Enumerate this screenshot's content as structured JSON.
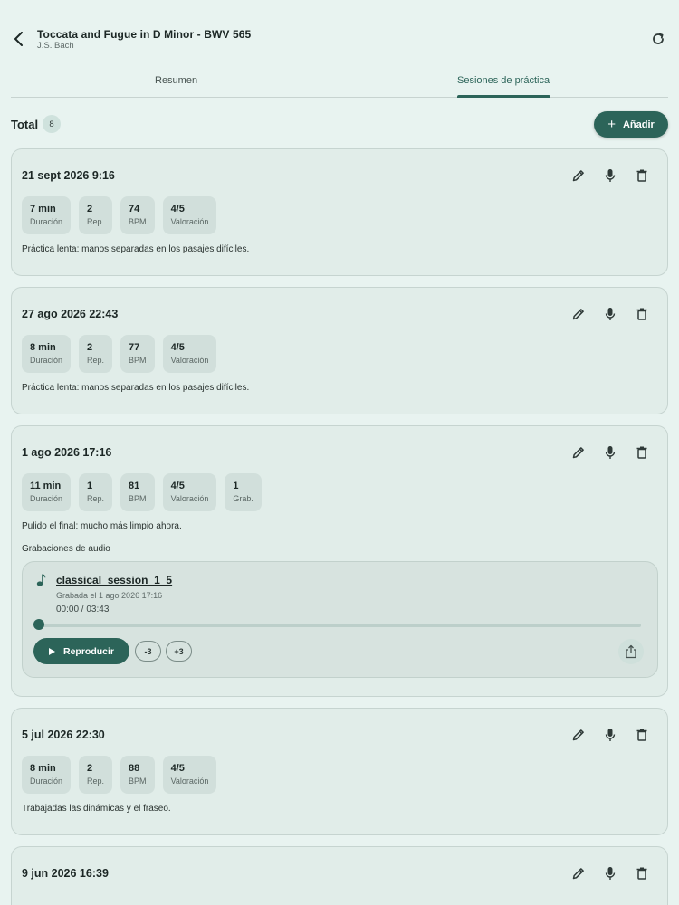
{
  "header": {
    "title": "Toccata and Fugue in D Minor - BWV 565",
    "subtitle": "J.S. Bach",
    "back_icon": "back-arrow-icon",
    "refresh_icon": "refresh-icon"
  },
  "tabs": [
    {
      "label": "Resumen",
      "active": false
    },
    {
      "label": "Sesiones de práctica",
      "active": true
    }
  ],
  "summary": {
    "total_label": "Total",
    "total_count": "8",
    "add_label": "Añadir"
  },
  "sessions": [
    {
      "date": "21 sept 2026 9:16",
      "stats": [
        {
          "value": "7 min",
          "label": "Duración"
        },
        {
          "value": "2",
          "label": "Rep."
        },
        {
          "value": "74",
          "label": "BPM"
        },
        {
          "value": "4/5",
          "label": "Valoración"
        }
      ],
      "note": "Práctica lenta: manos separadas en los pasajes difíciles."
    },
    {
      "date": "27 ago 2026 22:43",
      "stats": [
        {
          "value": "8 min",
          "label": "Duración"
        },
        {
          "value": "2",
          "label": "Rep."
        },
        {
          "value": "77",
          "label": "BPM"
        },
        {
          "value": "4/5",
          "label": "Valoración"
        }
      ],
      "note": "Práctica lenta: manos separadas en los pasajes difíciles."
    },
    {
      "date": "1 ago 2026 17:16",
      "stats": [
        {
          "value": "11 min",
          "label": "Duración"
        },
        {
          "value": "1",
          "label": "Rep."
        },
        {
          "value": "81",
          "label": "BPM"
        },
        {
          "value": "4/5",
          "label": "Valoración"
        },
        {
          "value": "1",
          "label": "Grab."
        }
      ],
      "note": "Pulido el final: mucho más limpio ahora.",
      "recordings_title": "Grabaciones de audio",
      "recording": {
        "name": "classical_session_1_5",
        "recorded": "Grabada el 1 ago 2026 17:16",
        "time": "00:00 / 03:43",
        "progress": 0,
        "play_label": "Reproducir",
        "skip_back": "-3",
        "skip_forward": "+3"
      }
    },
    {
      "date": "5 jul 2026 22:30",
      "stats": [
        {
          "value": "8 min",
          "label": "Duración"
        },
        {
          "value": "2",
          "label": "Rep."
        },
        {
          "value": "88",
          "label": "BPM"
        },
        {
          "value": "4/5",
          "label": "Valoración"
        }
      ],
      "note": "Trabajadas las dinámicas y el fraseo."
    },
    {
      "date": "9 jun 2026 16:39"
    }
  ],
  "colors": {
    "accent": "#2c6459",
    "background": "#e8f3f0",
    "card": "#e1ede9",
    "chip": "#d1dfdb"
  }
}
